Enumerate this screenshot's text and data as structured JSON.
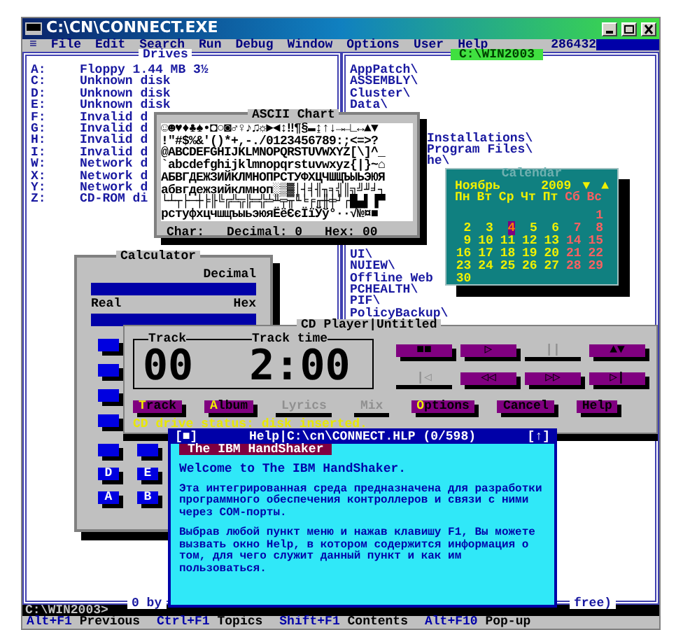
{
  "window": {
    "title": "C:\\CN\\CONNECT.EXE"
  },
  "menu": {
    "items": [
      {
        "label": "≡"
      },
      {
        "label": "File"
      },
      {
        "label": "Edit"
      },
      {
        "label": "Search"
      },
      {
        "label": "Run"
      },
      {
        "label": "Debug"
      },
      {
        "label": "Window"
      },
      {
        "label": "Options"
      },
      {
        "label": "User"
      },
      {
        "label": "Help"
      }
    ],
    "memory": "286432"
  },
  "drives_panel": {
    "title": "Drives",
    "items": [
      {
        "letter": "A:",
        "name": "Floppy 1.44 MB 3½"
      },
      {
        "letter": "C:",
        "name": "Unknown disk"
      },
      {
        "letter": "D:",
        "name": "Unknown disk"
      },
      {
        "letter": "E:",
        "name": "Unknown disk"
      },
      {
        "letter": "F:",
        "name": "Invalid d"
      },
      {
        "letter": "G:",
        "name": "Invalid d"
      },
      {
        "letter": "H:",
        "name": "Invalid d"
      },
      {
        "letter": "I:",
        "name": "Invalid d"
      },
      {
        "letter": "W:",
        "name": "Network d"
      },
      {
        "letter": "X:",
        "name": "Network d"
      },
      {
        "letter": "Y:",
        "name": "Network d"
      },
      {
        "letter": "Z:",
        "name": "CD-ROM di"
      }
    ]
  },
  "dir_panel": {
    "path": "C:\\WIN2003",
    "upper": [
      "AppPatch\\",
      "ASSEMBLY\\",
      "Cluster\\",
      "Data\\"
    ],
    "beside_chart": [
      "Installations\\",
      "Program Files\\",
      "he\\"
    ],
    "lower": [
      "UI\\",
      "NUIEW\\",
      "Offline Web",
      "PCHEALTH\\",
      "PIF\\",
      "PolicyBackup\\"
    ]
  },
  "footer": {
    "left": "0 by",
    "right": "free)"
  },
  "ascii_chart": {
    "title": "ASCII Chart",
    "rows": [
      "☺☻♥♦♣♠•◘○◙♂♀♪♫☼►◄↕‼¶§▬↨↑↓→←∟↔▲▼",
      "!\"#$%&'()*+,-./0123456789:;<=>?",
      "@ABCDEFGHIJKLMNOPQRSTUVWXYZ[\\]^_",
      "`abcdefghijklmnopqrstuvwxyz{|}~⌂",
      "АБВГДЕЖЗИЙКЛМНОПРСТУФХЦЧШЩЪЫЬЭЮЯ",
      "абвгдежзийклмноп░▒▓│┤╡╢╖╕╣║╗╝╜╛┐",
      "└┴┬├─┼╞╟╚╔╩╦╠═╬╧╨╤╥╙╘╒╓╫╪┘┌█▄▌▐▀",
      "рстуфхцчшщъыьэюяЁёЄєЇїЎў°∙·√№¤■"
    ],
    "char_label": "Char:",
    "decimal": "Decimal: 0",
    "hex": "Hex: 00"
  },
  "calendar": {
    "title": "Calendar",
    "month": "Ноябрь",
    "year": "2009",
    "prev": "▼",
    "next": "▲",
    "weekdays": [
      {
        "label": "Пн",
        "weekend": false
      },
      {
        "label": "Вт",
        "weekend": false
      },
      {
        "label": "Ср",
        "weekend": false
      },
      {
        "label": "Чт",
        "weekend": false
      },
      {
        "label": "Пт",
        "weekend": false
      },
      {
        "label": "Сб",
        "weekend": true
      },
      {
        "label": "Вс",
        "weekend": true
      }
    ],
    "weeks": [
      {
        "sun": {
          "day": "1",
          "selected": false
        }
      },
      {
        "mon": {
          "day": "2",
          "selected": false
        },
        "tue": {
          "day": "3",
          "selected": false
        },
        "wed": {
          "day": "4",
          "selected": true
        },
        "thu": {
          "day": "5",
          "selected": false
        },
        "fri": {
          "day": "6",
          "selected": false
        },
        "sat": {
          "day": "7",
          "selected": false
        },
        "sun": {
          "day": "8",
          "selected": false
        }
      },
      {
        "mon": {
          "day": "9",
          "selected": false
        },
        "tue": {
          "day": "10",
          "selected": false
        },
        "wed": {
          "day": "11",
          "selected": false
        },
        "thu": {
          "day": "12",
          "selected": false
        },
        "fri": {
          "day": "13",
          "selected": false
        },
        "sat": {
          "day": "14",
          "selected": false
        },
        "sun": {
          "day": "15",
          "selected": false
        }
      },
      {
        "mon": {
          "day": "16",
          "selected": false
        },
        "tue": {
          "day": "17",
          "selected": false
        },
        "wed": {
          "day": "18",
          "selected": false
        },
        "thu": {
          "day": "19",
          "selected": false
        },
        "fri": {
          "day": "20",
          "selected": false
        },
        "sat": {
          "day": "21",
          "selected": false
        },
        "sun": {
          "day": "22",
          "selected": false
        }
      },
      {
        "mon": {
          "day": "23",
          "selected": false
        },
        "tue": {
          "day": "24",
          "selected": false
        },
        "wed": {
          "day": "25",
          "selected": false
        },
        "thu": {
          "day": "26",
          "selected": false
        },
        "fri": {
          "day": "27",
          "selected": false
        },
        "sat": {
          "day": "28",
          "selected": false
        },
        "sun": {
          "day": "29",
          "selected": false
        }
      },
      {
        "mon": {
          "day": "30",
          "selected": false
        }
      }
    ]
  },
  "calculator": {
    "title": "Calculator",
    "mode_label": "Decimal",
    "left_label": "Real",
    "right_label": "Hex",
    "buttons": [
      {
        "label": "D"
      },
      {
        "label": "E"
      },
      {
        "label": "A"
      },
      {
        "label": "B"
      }
    ]
  },
  "cd_player": {
    "title": "CD Player|Untitled",
    "track_label": "Track",
    "time_label": "Track time",
    "track": "00",
    "time": "2:00",
    "transport": [
      {
        "label": "■■",
        "disabled": false
      },
      {
        "label": "▷",
        "disabled": false
      },
      {
        "label": "||",
        "disabled": true
      },
      {
        "label": "▲▼",
        "disabled": false
      },
      {
        "label": "|◁",
        "disabled": true
      },
      {
        "label": "◁◁",
        "disabled": false
      },
      {
        "label": "▷▷",
        "disabled": false
      },
      {
        "label": "▷|",
        "disabled": false
      }
    ],
    "buttons": [
      {
        "label": "Track",
        "hotkey": true,
        "disabled": false
      },
      {
        "label": "Album",
        "hotkey": true,
        "disabled": false
      },
      {
        "label": "Lyrics",
        "hotkey": false,
        "disabled": true
      },
      {
        "label": "Mix",
        "hotkey": false,
        "disabled": true
      },
      {
        "label": "Options",
        "hotkey": true,
        "disabled": false
      },
      {
        "label": "Cancel",
        "hotkey": false,
        "disabled": false
      },
      {
        "label": "Help",
        "hotkey": false,
        "disabled": false
      }
    ],
    "status": "CD drive status: disk inserted."
  },
  "help_window": {
    "close": "[■]",
    "title": "Help|C:\\cn\\CONNECT.HLP (0/598)",
    "zoom": "[↑]",
    "topic": "The IBM HandShaker",
    "paragraphs": [
      "Welcome to The IBM HandShaker.",
      "Эта интегрированная среда предназначена для разработки программного обеспечения контроллеров и связи с ними через COM-порты.",
      "Выбрав любой пункт меню и нажав клавишу F1, Вы можете вызвать окно Help, в котором содержится информация о том, для чего служит данный пункт и как им пользоваться."
    ]
  },
  "command_line": "C:\\WIN2003>",
  "key_bar": [
    {
      "key": "Alt+F1",
      "label": "Previous"
    },
    {
      "key": "Ctrl+F1",
      "label": "Topics"
    },
    {
      "key": "Shift+F1",
      "label": "Contents"
    },
    {
      "key": "Alt+F10",
      "label": "Pop-up"
    }
  ]
}
